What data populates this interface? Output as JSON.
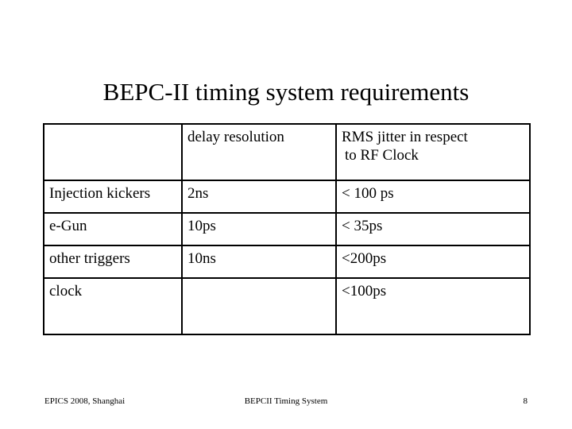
{
  "slide": {
    "title": "BEPC-II timing system requirements",
    "page_background": "#ffffff",
    "text_color": "#000000"
  },
  "table": {
    "border_color": "#000000",
    "columns": [
      {
        "key": "label",
        "header": ""
      },
      {
        "key": "delay",
        "header": "delay resolution"
      },
      {
        "key": "jitter",
        "header_line1": "RMS jitter in respect",
        "header_line2": " to RF Clock"
      }
    ],
    "rows": [
      {
        "label": "Injection kickers",
        "delay": "2ns",
        "jitter": "< 100 ps"
      },
      {
        "label": "e-Gun",
        "delay": "10ps",
        "jitter": "< 35ps"
      },
      {
        "label": "other triggers",
        "delay": "10ns",
        "jitter": "<200ps"
      },
      {
        "label": "clock",
        "delay": "",
        "jitter": "<100ps"
      }
    ]
  },
  "footer": {
    "left": "EPICS 2008, Shanghai",
    "center": "BEPCII Timing System",
    "page_number": "8"
  }
}
